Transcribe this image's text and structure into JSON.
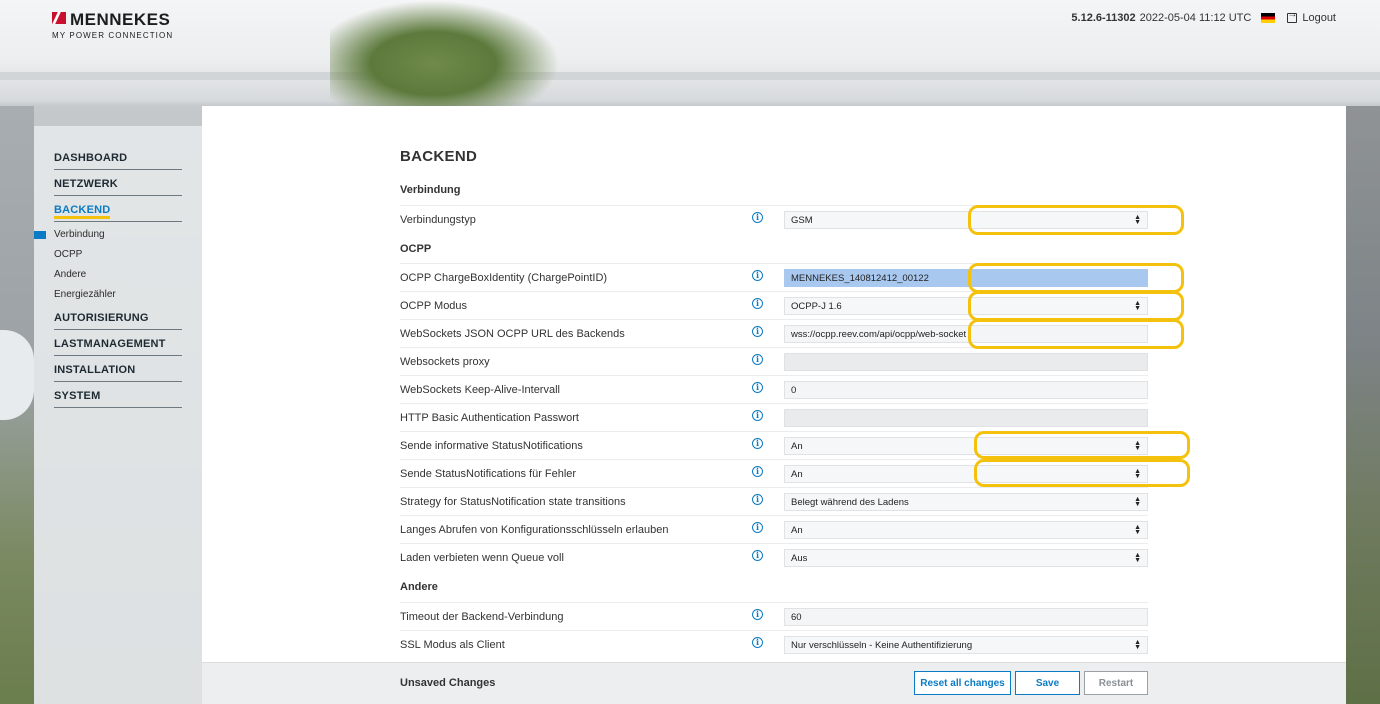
{
  "header": {
    "logo_name": "MENNEKES",
    "logo_tagline": "MY POWER CONNECTION",
    "version": "5.12.6-11302",
    "datetime": "2022-05-04 11:12 UTC",
    "logout_label": "Logout"
  },
  "sidebar": {
    "items": [
      {
        "label": "DASHBOARD"
      },
      {
        "label": "NETZWERK"
      },
      {
        "label": "BACKEND",
        "active": true
      },
      {
        "label": "AUTORISIERUNG"
      },
      {
        "label": "LASTMANAGEMENT"
      },
      {
        "label": "INSTALLATION"
      },
      {
        "label": "SYSTEM"
      }
    ],
    "backend_subitems": [
      {
        "label": "Verbindung",
        "current": true
      },
      {
        "label": "OCPP"
      },
      {
        "label": "Andere"
      },
      {
        "label": "Energiezähler"
      }
    ]
  },
  "main": {
    "title": "BACKEND",
    "sections": {
      "verbindung": "Verbindung",
      "ocpp": "OCPP",
      "andere": "Andere"
    },
    "rows": [
      {
        "label": "Verbindungstyp",
        "value": "GSM",
        "type": "select"
      },
      {
        "label": "OCPP ChargeBoxIdentity (ChargePointID)",
        "value": "MENNEKES_140812412_00122",
        "type": "input-highlight"
      },
      {
        "label": "OCPP Modus",
        "value": "OCPP-J 1.6",
        "type": "select"
      },
      {
        "label": "WebSockets JSON OCPP URL des Backends",
        "value": "wss://ocpp.reev.com/api/ocpp/web-socket",
        "type": "input"
      },
      {
        "label": "Websockets proxy",
        "value": "",
        "type": "readonly"
      },
      {
        "label": "WebSockets Keep-Alive-Intervall",
        "value": "0",
        "type": "input"
      },
      {
        "label": "HTTP Basic Authentication Passwort",
        "value": "",
        "type": "readonly"
      },
      {
        "label": "Sende informative StatusNotifications",
        "value": "An",
        "type": "select"
      },
      {
        "label": "Sende StatusNotifications für Fehler",
        "value": "An",
        "type": "select"
      },
      {
        "label": "Strategy for StatusNotification state transitions",
        "value": "Belegt während des Ladens",
        "type": "select"
      },
      {
        "label": "Langes Abrufen von Konfigurationsschlüsseln erlauben",
        "value": "An",
        "type": "select"
      },
      {
        "label": "Laden verbieten wenn Queue voll",
        "value": "Aus",
        "type": "select"
      },
      {
        "label": "Timeout der Backend-Verbindung",
        "value": "60",
        "type": "input"
      },
      {
        "label": "SSL Modus als Client",
        "value": "Nur verschlüsseln - Keine Authentifizierung",
        "type": "select"
      }
    ]
  },
  "footer": {
    "status": "Unsaved Changes",
    "reset_label": "Reset all changes",
    "save_label": "Save",
    "restart_label": "Restart"
  },
  "colors": {
    "accent": "#0a7bc4",
    "highlight_marker": "#f4c20d",
    "selected_field": "#a9c8f0",
    "brand_red": "#c8102e"
  },
  "icons": {
    "info": "info-icon",
    "select_caret": "select-caret-icon",
    "logout": "logout-icon",
    "language_flag": "german-flag-icon"
  }
}
